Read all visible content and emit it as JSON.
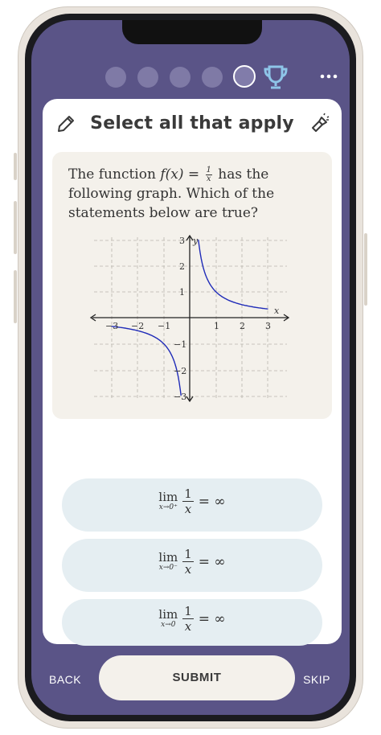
{
  "progress": {
    "dots": 5,
    "current": 5
  },
  "card": {
    "title": "Select all that apply"
  },
  "question": {
    "text_before": "The function ",
    "fx": "f(x) = ",
    "frac_num": "1",
    "frac_den": "x",
    "text_after": " has the following graph. Which of the statements below are true?"
  },
  "graph": {
    "x_label": "x",
    "y_label": "y",
    "x_ticks": [
      "−3",
      "−2",
      "−1",
      "1",
      "2",
      "3"
    ],
    "y_ticks": [
      "3",
      "2",
      "1",
      "−1",
      "−2",
      "−3"
    ]
  },
  "options": [
    {
      "lim": "lim",
      "sub": "x→0⁺",
      "num": "1",
      "den": "x",
      "rhs": "= ∞"
    },
    {
      "lim": "lim",
      "sub": "x→0⁻",
      "num": "1",
      "den": "x",
      "rhs": "= ∞"
    },
    {
      "lim": "lim",
      "sub": "x→0",
      "num": "1",
      "den": "x",
      "rhs": "= ∞"
    }
  ],
  "footer": {
    "back": "BACK",
    "submit": "SUBMIT",
    "skip": "SKIP"
  },
  "colors": {
    "screen": "#5a5487",
    "card": "#ffffff",
    "question_bg": "#f4f1eb",
    "option_bg": "#e5eef2",
    "curve": "#1f2bb8"
  }
}
